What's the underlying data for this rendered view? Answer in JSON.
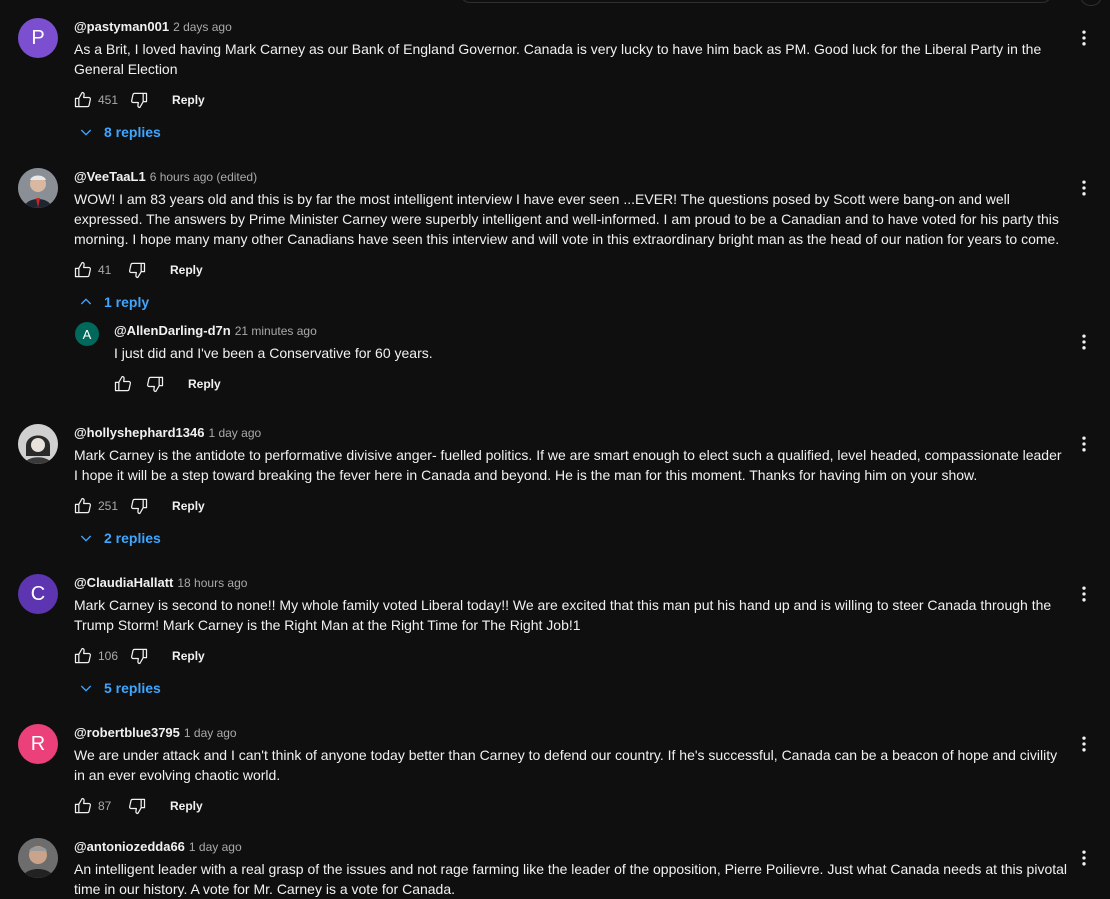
{
  "comments": [
    {
      "author": "@pastyman001",
      "time": "2 days ago",
      "avatar_letter": "P",
      "avatar_color": "#7b4fd0",
      "text": "As a Brit, I loved having Mark Carney as our Bank of England Governor.  Canada is very lucky to have him back as PM.  Good luck for the Liberal Party in the General Election",
      "likes": "451",
      "reply_label": "Reply",
      "replies_label": "8 replies"
    },
    {
      "author": "@VeeTaaL1",
      "time": "6 hours ago (edited)",
      "text": "WOW! I am 83 years old and this is by far the most intelligent interview I have ever seen ...EVER! The questions posed by Scott were bang-on and well expressed. The answers by Prime Minister Carney were superbly intelligent and well-informed. I am proud to be a Canadian and to have voted for his party this morning. I hope many many other Canadians have seen this interview and will vote in this extraordinary bright man as the head of our nation for years to come.",
      "likes": "41",
      "reply_label": "Reply",
      "replies_label": "1 reply"
    },
    {
      "author": "@hollyshephard1346",
      "time": "1 day ago",
      "text": "Mark Carney is the antidote to performative divisive anger- fuelled politics. If we are smart enough to elect such a qualified, level headed, compassionate leader I hope it will be a step toward breaking the fever here in Canada and beyond. He is the man for this moment. Thanks for having him on your show.",
      "likes": "251",
      "reply_label": "Reply",
      "replies_label": "2 replies"
    },
    {
      "author": "@ClaudiaHallatt",
      "time": "18 hours ago",
      "avatar_letter": "C",
      "avatar_color": "#5e35b1",
      "text": "Mark Carney is second to none!!  My whole family voted Liberal today!! We are excited that this man put his hand up and is willing to steer Canada through the Trump Storm! Mark Carney is the Right Man at the Right Time for The Right Job!1",
      "likes": "106",
      "reply_label": "Reply",
      "replies_label": "5 replies"
    },
    {
      "author": "@robertblue3795",
      "time": "1 day ago",
      "avatar_letter": "R",
      "avatar_color": "#ec407a",
      "text": "We are under attack and I can't think of anyone today better than Carney to defend our country. If he's successful, Canada can be a beacon of hope and civility in an ever evolving chaotic world.",
      "likes": "87",
      "reply_label": "Reply"
    },
    {
      "author": "@antoniozedda66",
      "time": "1 day ago",
      "text": "An intelligent leader with a real grasp of the issues and not rage farming like the leader of the opposition, Pierre Poilievre. Just what Canada needs at this pivotal time in our history. A vote for Mr. Carney is a vote for Canada."
    }
  ],
  "nested_reply": {
    "author": "@AllenDarling-d7n",
    "time": "21 minutes ago",
    "avatar_letter": "A",
    "avatar_color": "#00695c",
    "text": "I just did and I've been a Conservative for 60 years.",
    "reply_label": "Reply"
  },
  "icons": {
    "like": "thumbs-up-icon",
    "dislike": "thumbs-down-icon",
    "menu": "more-vert-icon",
    "expand": "chevron-down-icon",
    "collapse": "chevron-up-icon"
  }
}
